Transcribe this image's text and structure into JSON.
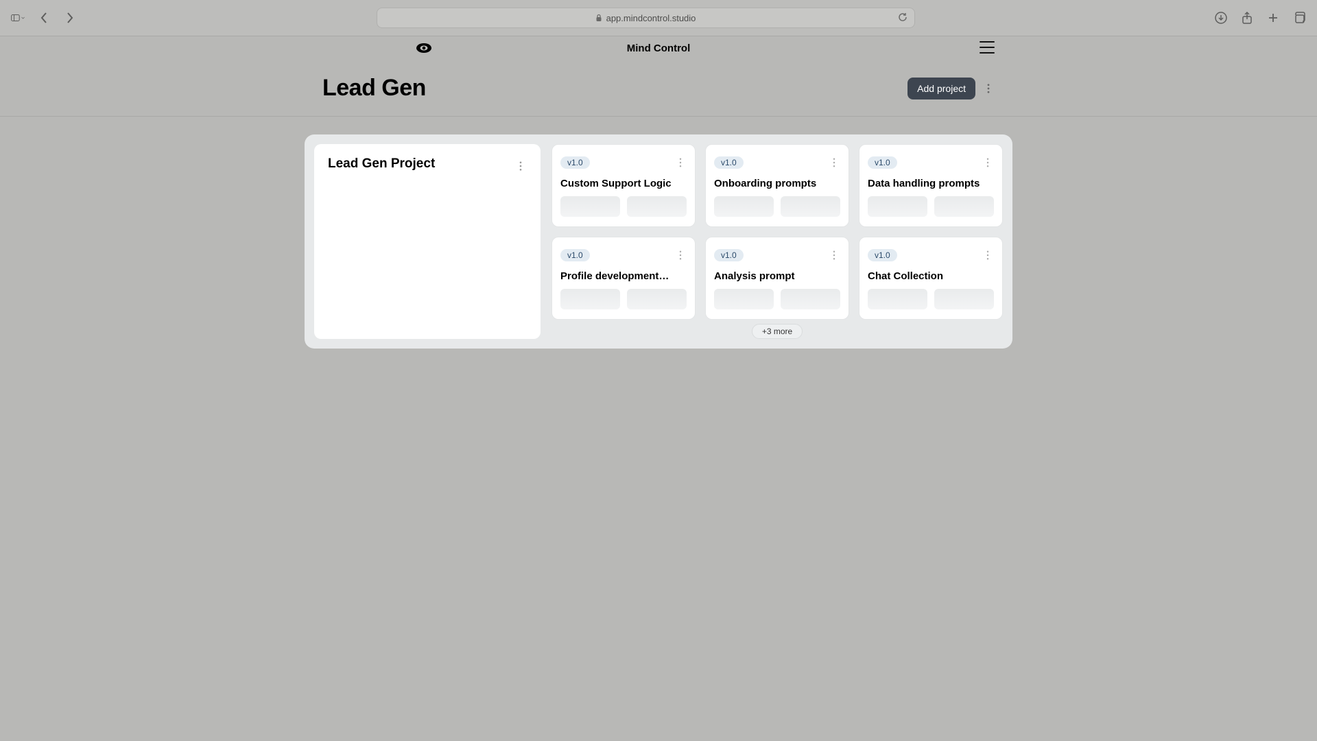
{
  "browser": {
    "url": "app.mindcontrol.studio"
  },
  "header": {
    "brand": "Mind Control"
  },
  "page": {
    "title": "Lead Gen",
    "add_button": "Add project"
  },
  "project": {
    "name": "Lead Gen Project",
    "more_label": "+3 more",
    "cards": [
      {
        "version": "v1.0",
        "title": "Custom Support Logic"
      },
      {
        "version": "v1.0",
        "title": "Onboarding prompts"
      },
      {
        "version": "v1.0",
        "title": "Data handling prompts"
      },
      {
        "version": "v1.0",
        "title": "Profile development…"
      },
      {
        "version": "v1.0",
        "title": "Analysis prompt"
      },
      {
        "version": "v1.0",
        "title": "Chat Collection"
      }
    ]
  }
}
